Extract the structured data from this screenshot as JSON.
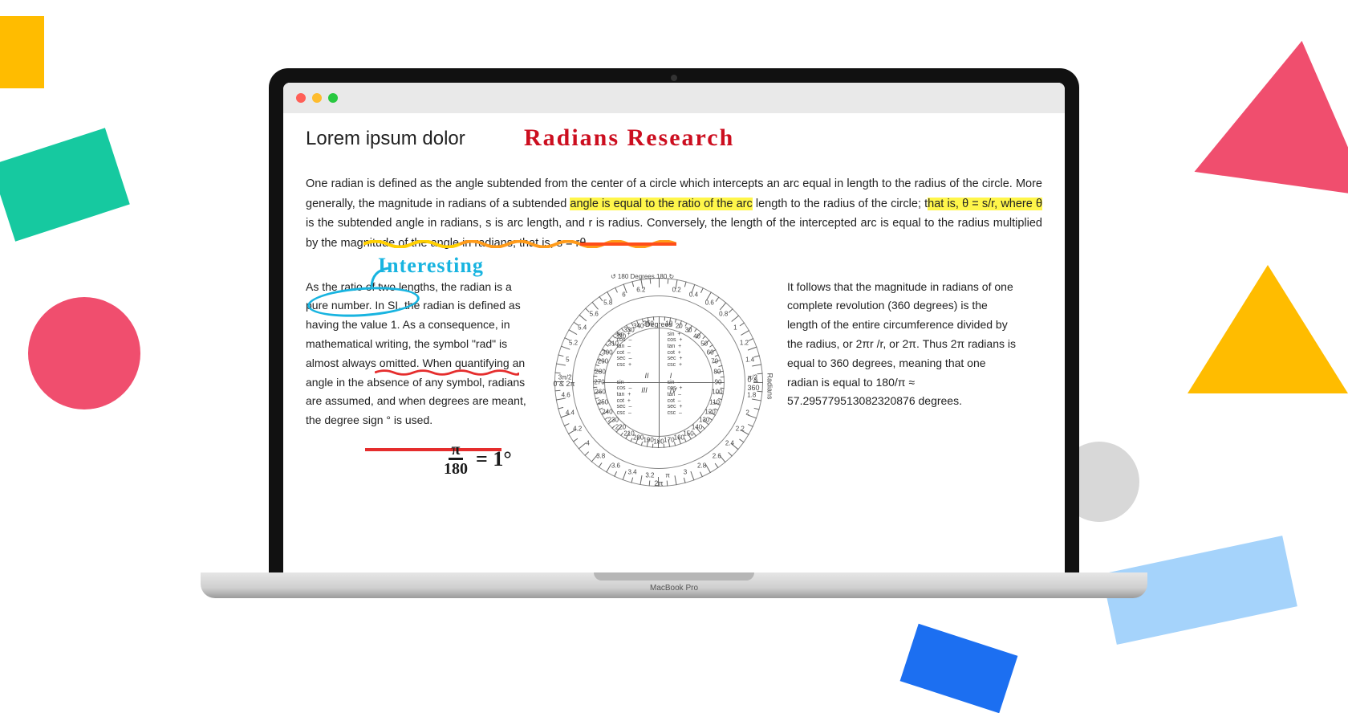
{
  "device": {
    "label": "MacBook Pro"
  },
  "heading": "Lorem ipsum dolor",
  "annotations": {
    "title_handwriting": "Radians Research",
    "interesting": "Interesting",
    "formula_numerator": "π",
    "formula_denominator": "180",
    "formula_rhs": "= 1°"
  },
  "paragraph_top": {
    "pre1": "One radian is defined as the angle subtended from the center of a circle which intercepts an arc equal in length to the radius of the circle. More generally, the magnitude in radians of a subtended ",
    "hl1": "angle is equal to the ratio of the arc",
    "mid1": " length to the radius of the circle; t",
    "hl2": "hat is, θ = s/r, where θ",
    "post1": " is the subtended angle in radians, s is arc length, and r is radius. Conversely, the length of the intercepted arc is equal to the radius multiplied by the magnitude of the angle in radians; that is, s = rθ."
  },
  "col_left": "As the ratio of two lengths, the radian is a pure number. In SI, the radian is defined as having the value 1. As a consequence, in mathematical writing, the symbol \"rad\" is almost always omitted. When quantifying an angle in the absence of any symbol, radians are assumed, and when degrees are meant, the degree sign ° is used.",
  "col_right": "It follows that the magnitude in radians of one complete revolution (360 degrees) is the length of the entire circumference divided by the radius, or 2πr /r, or 2π. Thus 2π radians is equal to 360 degrees, meaning that one radian is equal to 180/π ≈ 57.295779513082320876 degrees.",
  "protractor": {
    "top_label": "Degrees",
    "left_label_deg": "Degrees",
    "right_label_rad": "Radians",
    "top_left_arrow": "↺ 180",
    "top_right_arrow": "180 ↻",
    "quadrants": [
      "I",
      "II",
      "III",
      "IV"
    ],
    "bottom_label": "2π",
    "zero_right": "0 & 360",
    "zero_left": "0 & 2π",
    "trig_sets": [
      {
        "q": "I",
        "pos": "tr",
        "lines": "sin  +\ncos  +\ntan  +\ncot  +\nsec  +\ncsc  +"
      },
      {
        "q": "II",
        "pos": "tl",
        "lines": "sin  +\ncos  –\ntan  –\ncot  –\nsec  –\ncsc  +"
      },
      {
        "q": "III",
        "pos": "bl",
        "lines": "sin  –\ncos  –\ntan  +\ncot  +\nsec  –\ncsc  –"
      },
      {
        "q": "IV",
        "pos": "br",
        "lines": "sin  –\ncos  +\ntan  –\ncot  –\nsec  +\ncsc  –"
      }
    ],
    "degree_ticks": [
      10,
      20,
      30,
      40,
      50,
      60,
      70,
      80,
      90,
      100,
      110,
      120,
      130,
      140,
      150,
      160,
      170,
      180,
      190,
      200,
      210,
      220,
      230,
      240,
      250,
      260,
      270,
      280,
      290,
      300,
      310,
      320,
      330,
      340,
      350
    ],
    "radian_ticks": [
      "0.2",
      "0.4",
      "0.6",
      "0.8",
      "1",
      "1.2",
      "1.4",
      "π/2",
      "1.8",
      "2",
      "2.2",
      "2.4",
      "2.6",
      "2.8",
      "3",
      "π",
      "3.2",
      "3.4",
      "3.6",
      "3.8",
      "4",
      "4.2",
      "4.4",
      "4.6",
      "3π/2",
      "5",
      "5.2",
      "5.4",
      "5.6",
      "5.8",
      "6",
      "6.2"
    ]
  }
}
